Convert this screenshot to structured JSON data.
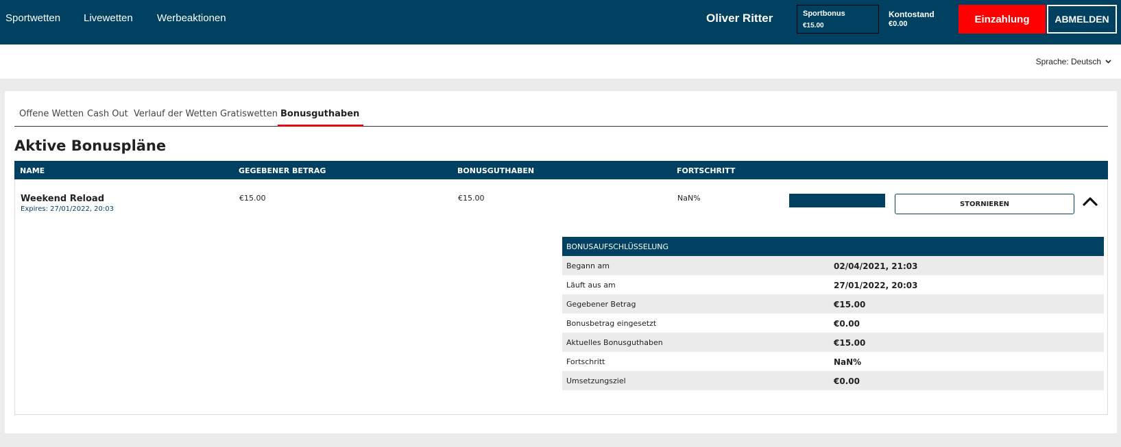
{
  "nav": {
    "items": [
      "Sportwetten",
      "Livewetten",
      "Werbeaktionen"
    ]
  },
  "account": {
    "username": "Oliver Ritter",
    "sportbonus_label": "Sportbonus",
    "sportbonus_value": "€15.00",
    "kontostand_label": "Kontostand",
    "kontostand_value": "€0.00",
    "deposit_label": "Einzahlung",
    "logout_label": "ABMELDEN"
  },
  "language": {
    "label": "Sprache: Deutsch"
  },
  "tabs": [
    {
      "label": "Offene Wetten"
    },
    {
      "label": "Cash Out"
    },
    {
      "label": "Verlauf der Wetten"
    },
    {
      "label": "Gratiswetten"
    },
    {
      "label": "Bonusguthaben",
      "active": true
    }
  ],
  "section_title": "Aktive Bonuspläne",
  "table": {
    "headers": [
      "NAME",
      "GEGEBENER BETRAG",
      "BONUSGUTHABEN",
      "FORTSCHRITT"
    ],
    "row": {
      "name": "Weekend Reload",
      "expires": "Expires: 27/01/2022, 20:03",
      "given_amount": "€15.00",
      "bonus_balance": "€15.00",
      "progress": "NaN%",
      "progress_fraction": 1.0,
      "cancel_label": "STORNIEREN"
    }
  },
  "breakdown": {
    "title": "BONUSAUFSCHLÜSSELUNG",
    "rows": [
      {
        "label": "Begann am",
        "value": "02/04/2021, 21:03"
      },
      {
        "label": "Läuft aus am",
        "value": "27/01/2022, 20:03"
      },
      {
        "label": "Gegebener Betrag",
        "value": "€15.00"
      },
      {
        "label": "Bonusbetrag eingesetzt",
        "value": "€0.00"
      },
      {
        "label": "Aktuelles Bonusguthaben",
        "value": "€15.00"
      },
      {
        "label": "Fortschritt",
        "value": "NaN%"
      },
      {
        "label": "Umsetzungsziel",
        "value": "€0.00"
      }
    ]
  },
  "colors": {
    "primary": "#004162",
    "accent_red": "#ff0000",
    "tab_underline": "#e30613",
    "row_shade": "#ebebeb"
  }
}
